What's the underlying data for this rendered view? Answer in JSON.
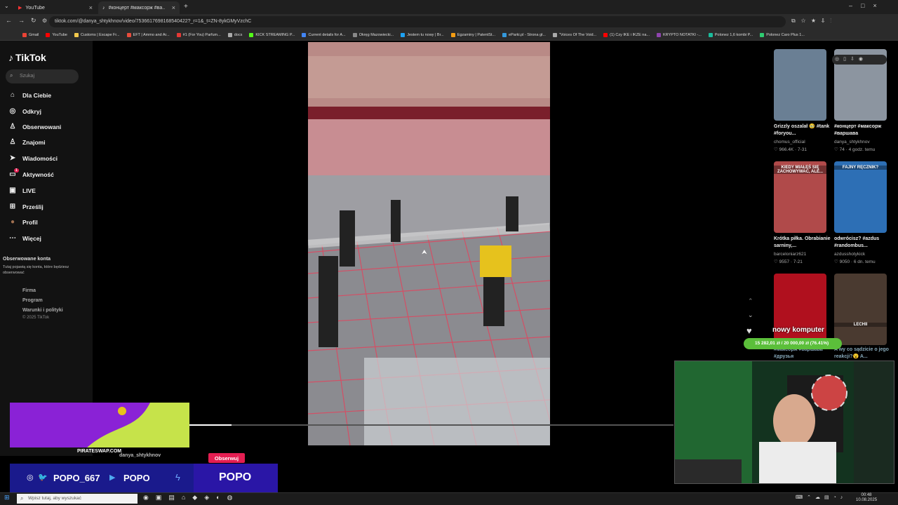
{
  "browser": {
    "tabs": [
      {
        "title": "YouTube",
        "active": false
      },
      {
        "title": "#концерт #максорж #вa…",
        "active": true
      }
    ],
    "url": "tiktok.com/@danya_shtykhnov/video/7536617698168540422?_r=1&_t=ZN-8ykGMyVzchC",
    "bookmarks": [
      "Gmail",
      "YouTube",
      "Customs | Escape Fr...",
      "EFT | Ammo and Ar...",
      "#1 (For You) Parfum...",
      "docs",
      "KICK STREAMING P...",
      "Current details for A...",
      "Okręg Mazowiecki...",
      "Jestem tu nowy | Br...",
      "Egzaminy | PatentSt...",
      "eParki.pl - Strona gł...",
      "\"Voices Of The Void...",
      "(1) Czy IKE i IKZE na...",
      "KRYPTO NOTATKI -...",
      "Polonez 1,6 kombi P...",
      "Polonez Caro Plus 1..."
    ]
  },
  "sidebar": {
    "logo": "TikTok",
    "search_placeholder": "Szukaj",
    "items": [
      {
        "label": "Dla Ciebie",
        "icon": "home-icon"
      },
      {
        "label": "Odkryj",
        "icon": "compass-icon"
      },
      {
        "label": "Obserwowani",
        "icon": "following-icon"
      },
      {
        "label": "Znajomi",
        "icon": "friends-icon"
      },
      {
        "label": "Wiadomości",
        "icon": "send-icon"
      },
      {
        "label": "Aktywność",
        "icon": "inbox-icon",
        "badge": "1"
      },
      {
        "label": "LIVE",
        "icon": "live-icon"
      },
      {
        "label": "Prześlij",
        "icon": "upload-icon"
      },
      {
        "label": "Profil",
        "icon": "avatar-icon"
      },
      {
        "label": "Więcej",
        "icon": "more-icon"
      }
    ],
    "followed_heading": "Obserwowane konta",
    "followed_text": "Tutaj pojawią się konta, które będziesz obserwować",
    "footer_links": [
      "Firma",
      "Program",
      "Warunki i polityki"
    ],
    "copyright": "© 2025 TikTok"
  },
  "video": {
    "creator": "danya_shtykhnov",
    "follow_label": "Obserwuj",
    "progress": 0.087
  },
  "recommended": [
    {
      "caption": "Grizzly oszalał 🥹 #tank #foryou...",
      "user": "chomus_official",
      "stats": "♡ 966.4K · 7-31"
    },
    {
      "caption": "#концерт #максорж #варшава",
      "user": "danya_shtykhnov",
      "stats": "♡ 74 · 4 godz. temu"
    },
    {
      "caption": "Krótka piłka. Obrabianie sarniny,...",
      "user": "barceloniarz621",
      "stats": "♡ 9557 · 7-21",
      "thumb_text": "KIEDY MIAŁEŚ SIĘ ZACHOWYWAĆ, ALE..."
    },
    {
      "caption": "odwrócisz? #azdus #randombus...",
      "user": "azdusshotykick",
      "stats": "♡ 9050 · 6 dn. temu",
      "thumb_text": "FAJNY RĘCZNIK?"
    },
    {
      "caption": "#максорж #варшава #друзья",
      "user": "",
      "stats": "",
      "thumb_text": ""
    },
    {
      "caption": "A wy co sądzicie o jego reakcji?😮 A...",
      "user": "",
      "stats": "",
      "thumb_text": "LECHII"
    }
  ],
  "overlay": {
    "goal_title": "nowy komputer",
    "goal_text": "15 282,01 zł / 20 000,00 zł (76.41%)",
    "goal_fraction": 0.7641,
    "promo_url": "PIRATESWAP.COM",
    "socials": [
      {
        "icon": "instagram-icon",
        "handle": "POPO_667"
      },
      {
        "icon": "youtube-icon",
        "handle": "POPO"
      }
    ],
    "kick_name": "POPO"
  },
  "taskbar": {
    "search_placeholder": "Wpisz tutaj, aby wyszukać",
    "time": "00:48",
    "date": "10.08.2025"
  }
}
